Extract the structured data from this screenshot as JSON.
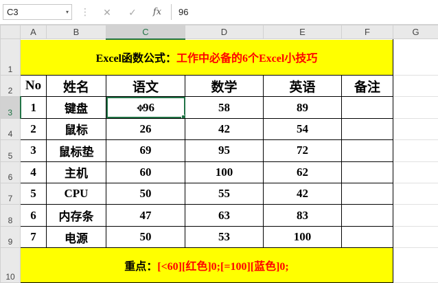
{
  "formula_bar": {
    "name_box": "C3",
    "name_box_arrow": "▾",
    "dots": "⋮",
    "cancel": "✕",
    "enter": "✓",
    "fx": "fx",
    "value": "96"
  },
  "columns": [
    "A",
    "B",
    "C",
    "D",
    "E",
    "F",
    "G"
  ],
  "rows": [
    "1",
    "2",
    "3",
    "4",
    "5",
    "6",
    "7",
    "8",
    "9",
    "10"
  ],
  "title": {
    "black": "Excel函数公式：",
    "red": "工作中必备的6个Excel小技巧"
  },
  "headers": [
    "No",
    "姓名",
    "语文",
    "数学",
    "英语",
    "备注"
  ],
  "table": [
    {
      "no": "1",
      "name": "键盘",
      "chinese": "96",
      "math": "58",
      "english": "89",
      "note": ""
    },
    {
      "no": "2",
      "name": "鼠标",
      "chinese": "26",
      "math": "42",
      "english": "54",
      "note": ""
    },
    {
      "no": "3",
      "name": "鼠标垫",
      "chinese": "69",
      "math": "95",
      "english": "72",
      "note": ""
    },
    {
      "no": "4",
      "name": "主机",
      "chinese": "60",
      "math": "100",
      "english": "62",
      "note": ""
    },
    {
      "no": "5",
      "name": "CPU",
      "chinese": "50",
      "math": "55",
      "english": "42",
      "note": ""
    },
    {
      "no": "6",
      "name": "内存条",
      "chinese": "47",
      "math": "63",
      "english": "83",
      "note": ""
    },
    {
      "no": "7",
      "name": "电源",
      "chinese": "50",
      "math": "53",
      "english": "100",
      "note": ""
    }
  ],
  "footer": {
    "black": "重点：",
    "red": "[<60][红色]0;[=100][蓝色]0;"
  },
  "colors": {
    "banner_bg": "#ffff00",
    "title_red": "#ff0000",
    "selection": "#217346"
  },
  "selected_cell": "C3"
}
